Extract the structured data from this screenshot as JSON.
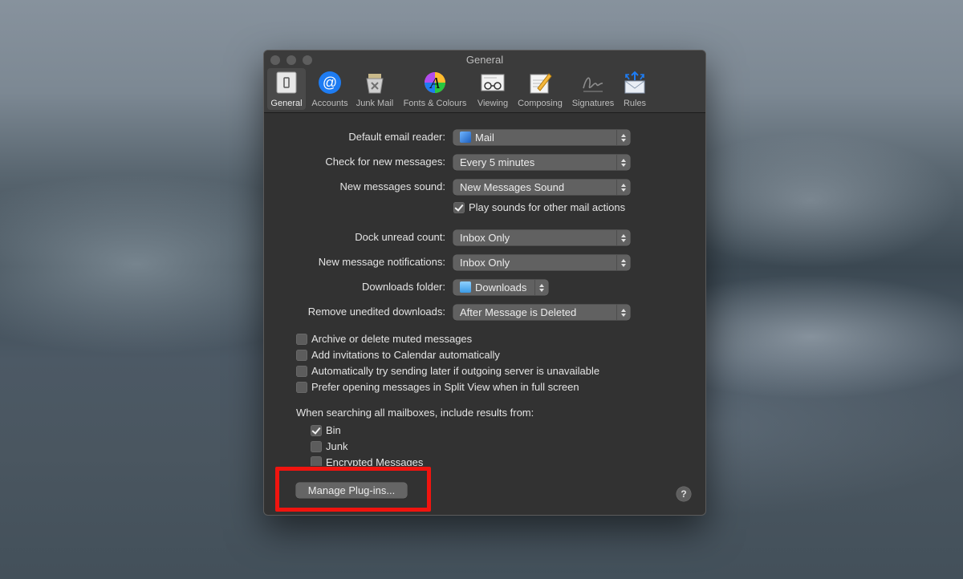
{
  "window": {
    "title": "General"
  },
  "toolbar": {
    "tabs": [
      {
        "label": "General",
        "icon": "general-icon",
        "active": true
      },
      {
        "label": "Accounts",
        "icon": "at-sign-icon"
      },
      {
        "label": "Junk Mail",
        "icon": "junk-bin-icon"
      },
      {
        "label": "Fonts & Colours",
        "icon": "fonts-colours-icon"
      },
      {
        "label": "Viewing",
        "icon": "glasses-icon"
      },
      {
        "label": "Composing",
        "icon": "pencil-note-icon"
      },
      {
        "label": "Signatures",
        "icon": "signature-icon"
      },
      {
        "label": "Rules",
        "icon": "envelope-arrows-icon"
      }
    ]
  },
  "settings": {
    "default_email_reader": {
      "label": "Default email reader:",
      "value": "Mail"
    },
    "check_new": {
      "label": "Check for new messages:",
      "value": "Every 5 minutes"
    },
    "sound": {
      "label": "New messages sound:",
      "value": "New Messages Sound"
    },
    "play_sounds": {
      "label": "Play sounds for other mail actions",
      "checked": true
    },
    "dock_unread": {
      "label": "Dock unread count:",
      "value": "Inbox Only"
    },
    "notifications": {
      "label": "New message notifications:",
      "value": "Inbox Only"
    },
    "downloads_folder": {
      "label": "Downloads folder:",
      "value": "Downloads"
    },
    "remove_downloads": {
      "label": "Remove unedited downloads:",
      "value": "After Message is Deleted"
    }
  },
  "options": [
    {
      "label": "Archive or delete muted messages",
      "checked": false
    },
    {
      "label": "Add invitations to Calendar automatically",
      "checked": false
    },
    {
      "label": "Automatically try sending later if outgoing server is unavailable",
      "checked": false
    },
    {
      "label": "Prefer opening messages in Split View when in full screen",
      "checked": false
    }
  ],
  "search": {
    "label": "When searching all mailboxes, include results from:",
    "items": [
      {
        "label": "Bin",
        "checked": true
      },
      {
        "label": "Junk",
        "checked": false
      },
      {
        "label": "Encrypted Messages",
        "checked": false
      }
    ]
  },
  "manage_plugins_label": "Manage Plug-ins...",
  "help_label": "?",
  "colors": {
    "highlight": "#f0140f",
    "window_bg": "#323232",
    "accent_blue": "#1e7cf2"
  }
}
